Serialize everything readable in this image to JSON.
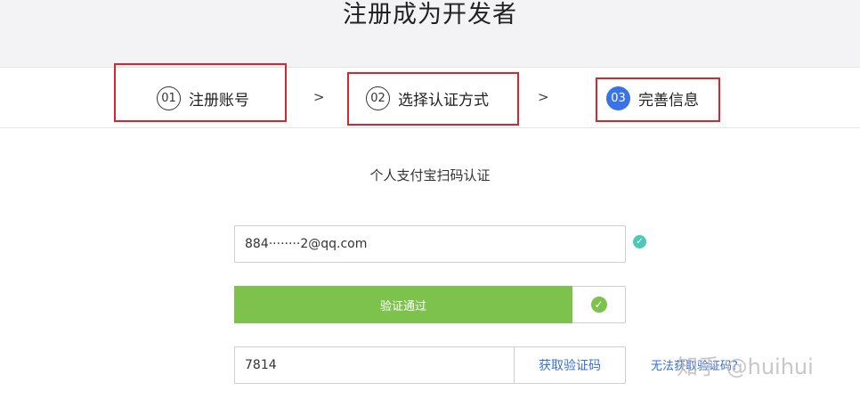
{
  "header": {
    "title": "注册成为开发者"
  },
  "steps": [
    {
      "num": "01",
      "label": "注册账号"
    },
    {
      "num": "02",
      "label": "选择认证方式"
    },
    {
      "num": "03",
      "label": "完善信息"
    }
  ],
  "step_separator": ">",
  "form": {
    "section_title": "个人支付宝扫码认证",
    "account_value": "884········2@qq.com",
    "verify_label": "验证通过",
    "code_value": "7814",
    "get_code_label": "获取验证码",
    "no_code_label": "无法获取验证码?"
  },
  "watermark": "知乎 @huihui",
  "colors": {
    "accent_blue": "#3a73e6",
    "success_green": "#7cc24c",
    "highlight_red": "#d9252d",
    "valid_teal": "#4cc9b6"
  },
  "icons": {
    "valid": "check-circle-icon",
    "verified": "check-circle-icon"
  }
}
